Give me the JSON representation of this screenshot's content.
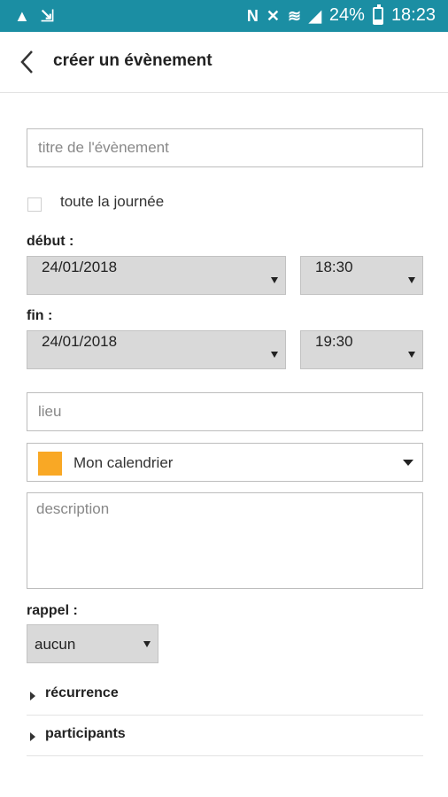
{
  "status_bar": {
    "battery_percent": "24%",
    "battery_level": 0.24,
    "time": "18:23",
    "left_icons": [
      "warning-icon",
      "download-icon"
    ],
    "right_icons": [
      "nfc-icon",
      "mute-icon",
      "wifi-icon",
      "signal-icon",
      "battery-icon"
    ]
  },
  "header": {
    "title": "créer un évènement",
    "back_icon": "chevron-left-icon"
  },
  "form": {
    "title_placeholder": "titre de l'évènement",
    "all_day_label": "toute la journée",
    "start_label": "début :",
    "start_date": "24/01/2018",
    "start_time": "18:30",
    "end_label": "fin :",
    "end_date": "24/01/2018",
    "end_time": "19:30",
    "location_placeholder": "lieu",
    "calendar_name": "Mon calendrier",
    "calendar_color": "#f9a825",
    "description_placeholder": "description",
    "reminder_label": "rappel :",
    "reminder_value": "aucun",
    "recurrence_label": "récurrence",
    "participants_label": "participants"
  },
  "colors": {
    "status_bar_bg": "#1b8ea3",
    "select_bg": "#d9d9d9"
  }
}
